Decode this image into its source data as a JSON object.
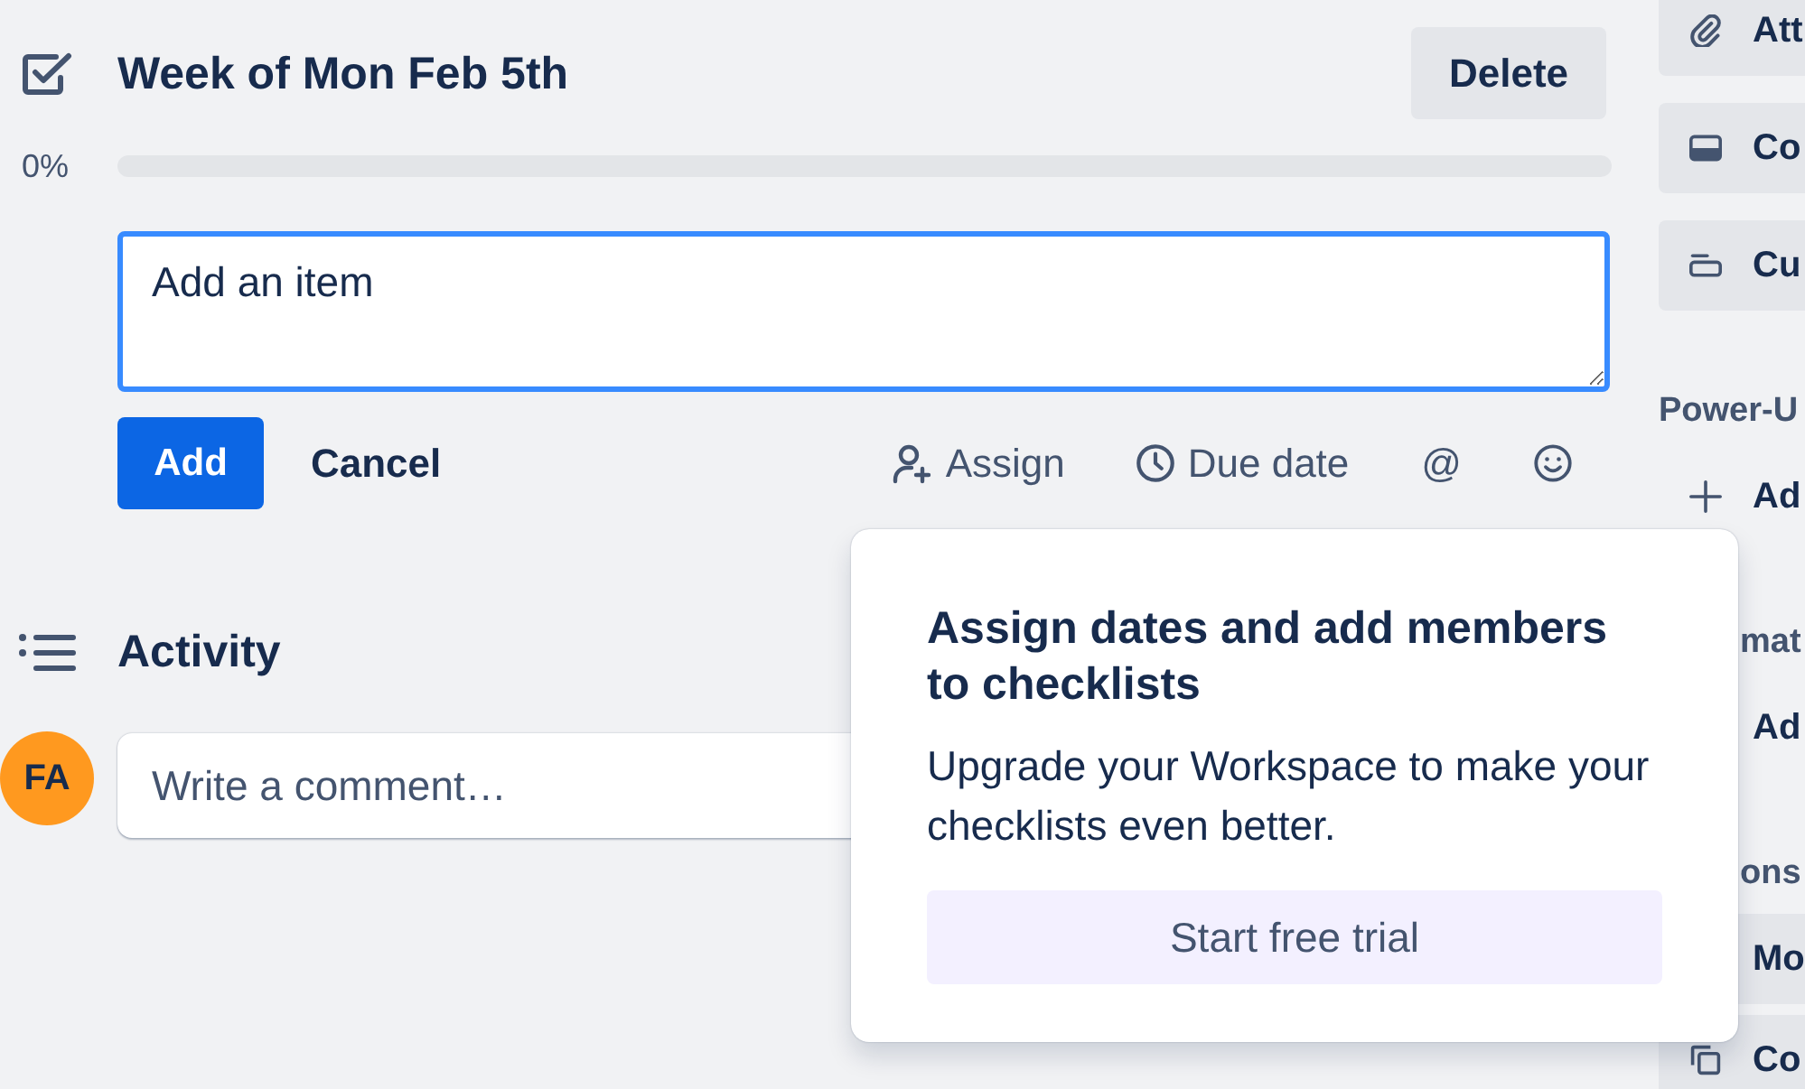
{
  "checklist": {
    "title": "Week of Mon Feb 5th",
    "delete_button": "Delete",
    "progress": {
      "label": "0%",
      "level": 0
    },
    "new_item": {
      "placeholder": "Add an item"
    },
    "add_button": "Add",
    "cancel_button": "Cancel",
    "tools": [
      {
        "kind": "assign",
        "label": "Assign"
      },
      {
        "kind": "due",
        "label": "Due date"
      },
      {
        "kind": "mention",
        "label": "@"
      },
      {
        "kind": "emoji"
      }
    ]
  },
  "activity": {
    "title": "Activity",
    "avatar": "FA",
    "comment": {
      "placeholder": "Write a comment…"
    }
  },
  "sidebar": {
    "buttons": [
      {
        "label": "Att"
      },
      {
        "label": "Co"
      },
      {
        "label": "Cu"
      }
    ],
    "sections": [
      {
        "heading": "Power-U",
        "items": [
          {
            "kind": "link",
            "label": "Ad"
          }
        ]
      },
      {
        "heading": "mat",
        "items": [
          {
            "kind": "link",
            "label": "Ad"
          }
        ]
      },
      {
        "heading": "ons",
        "items": [
          {
            "kind": "button",
            "label": "Mo"
          },
          {
            "kind": "button",
            "label": "Co"
          }
        ]
      }
    ]
  },
  "popover": {
    "title": "Assign dates and add members to checklists",
    "body": "Upgrade your Workspace to make your checklists even better.",
    "button": "Start free trial"
  }
}
